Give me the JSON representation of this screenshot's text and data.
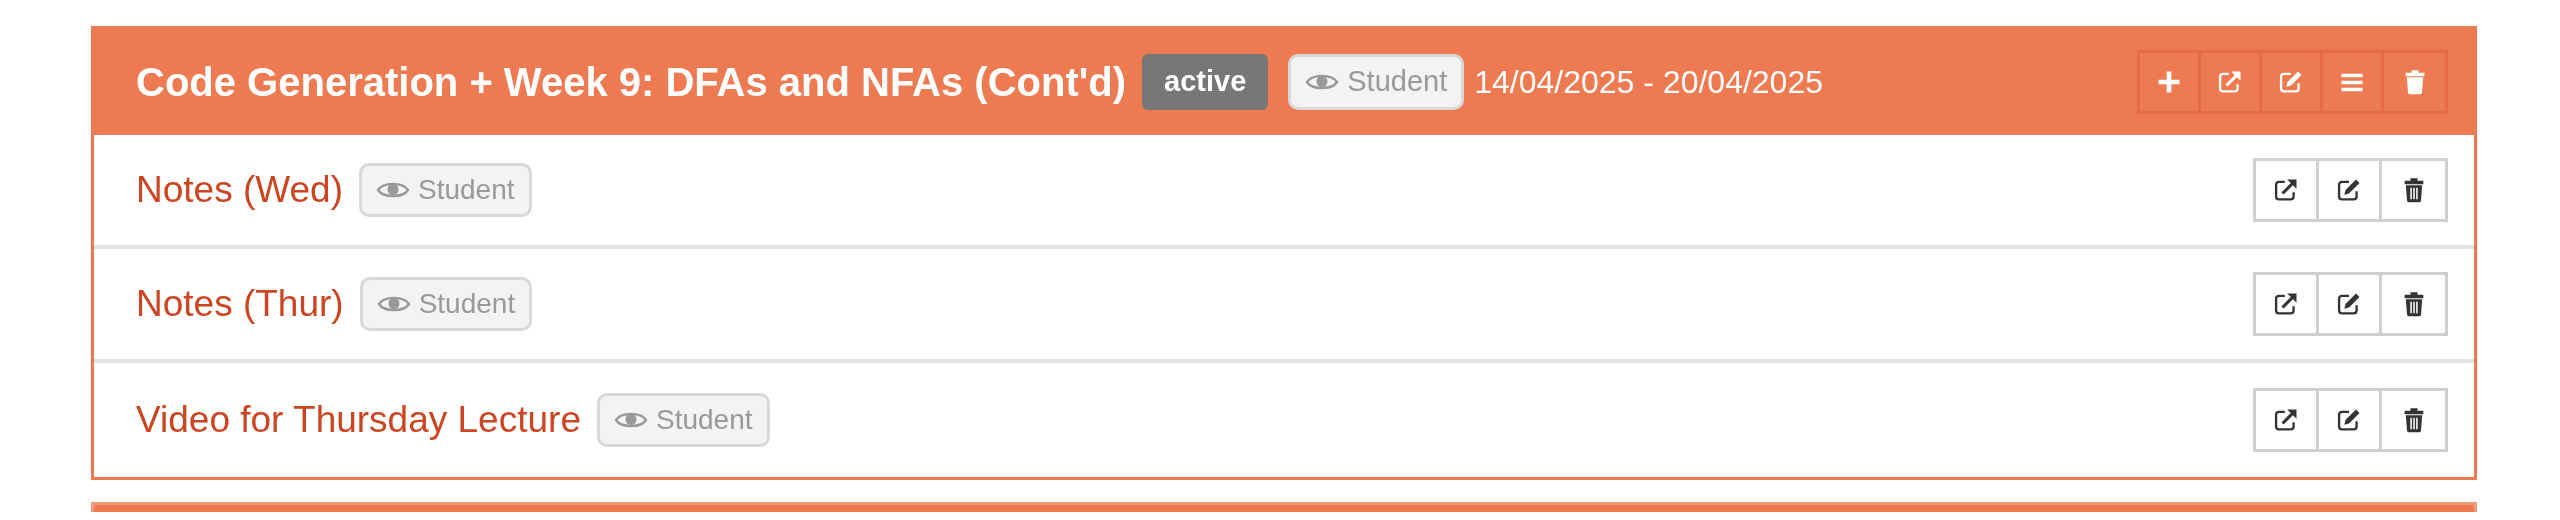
{
  "section": {
    "title": "Code Generation + Week 9: DFAs and NFAs (Cont'd)",
    "status": "active",
    "visibility": "Student",
    "dates": "14/04/2025 - 20/04/2025",
    "actions": [
      {
        "kind": "add"
      },
      {
        "kind": "open"
      },
      {
        "kind": "edit"
      },
      {
        "kind": "reorder"
      },
      {
        "kind": "delete"
      }
    ]
  },
  "items": [
    {
      "title": "Notes (Wed)",
      "visibility": "Student",
      "actions": [
        {
          "kind": "open"
        },
        {
          "kind": "edit"
        },
        {
          "kind": "delete"
        }
      ]
    },
    {
      "title": "Notes (Thur)",
      "visibility": "Student",
      "actions": [
        {
          "kind": "open"
        },
        {
          "kind": "edit"
        },
        {
          "kind": "delete"
        }
      ]
    },
    {
      "title": "Video for Thursday Lecture",
      "visibility": "Student",
      "actions": [
        {
          "kind": "open"
        },
        {
          "kind": "edit"
        },
        {
          "kind": "delete"
        }
      ]
    }
  ]
}
